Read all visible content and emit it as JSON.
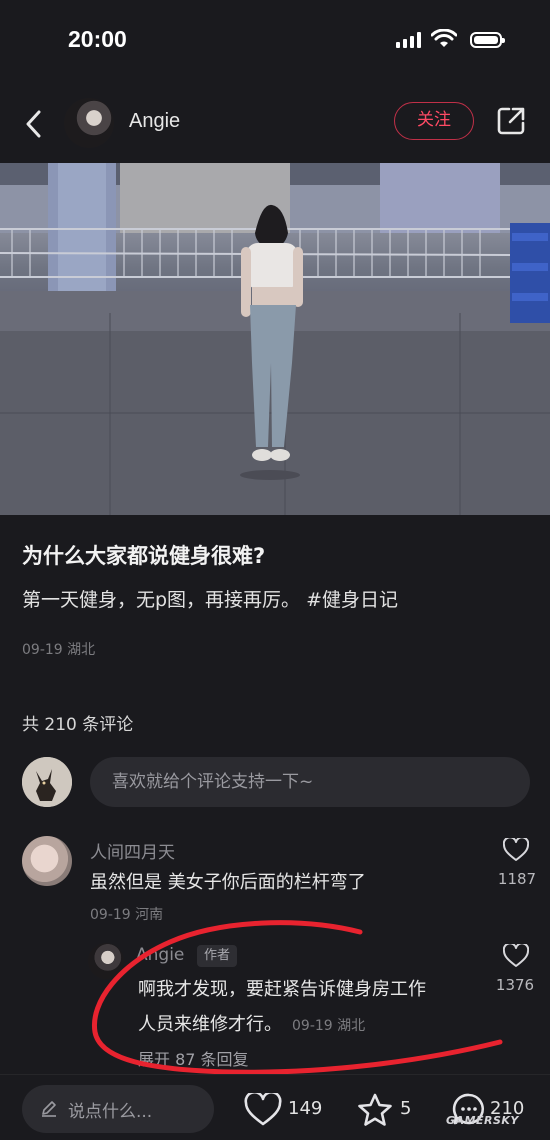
{
  "status_bar": {
    "time": "20:00"
  },
  "header": {
    "author_name": "Angie",
    "follow_label": "关注"
  },
  "post": {
    "title": "为什么大家都说健身很难?",
    "body": "第一天健身，无p图，再接再厉。",
    "hashtag": "#健身日记",
    "meta": "09-19 湖北"
  },
  "comments_section": {
    "count_label": "共 210 条评论",
    "input_placeholder": "喜欢就给个评论支持一下~"
  },
  "comments": [
    {
      "username": "人间四月天",
      "text": "虽然但是 美女子你后面的栏杆弯了",
      "meta": "09-19 河南",
      "likes": "1187"
    },
    {
      "username": "Angie",
      "badge": "作者",
      "text_line1": "啊我才发现，要赶紧告诉健身房工作",
      "text_line2": "人员来维修才行。",
      "meta": "09-19 湖北",
      "likes": "1376",
      "expand_label": "展开 87 条回复"
    }
  ],
  "bottom_bar": {
    "reply_placeholder": "说点什么...",
    "like_count": "149",
    "star_count": "5",
    "comment_count": "210"
  },
  "watermark": "GAMERSKY",
  "colors": {
    "background": "#1a1a1e",
    "accent": "#ff4a64",
    "annotation": "#e8232f"
  }
}
